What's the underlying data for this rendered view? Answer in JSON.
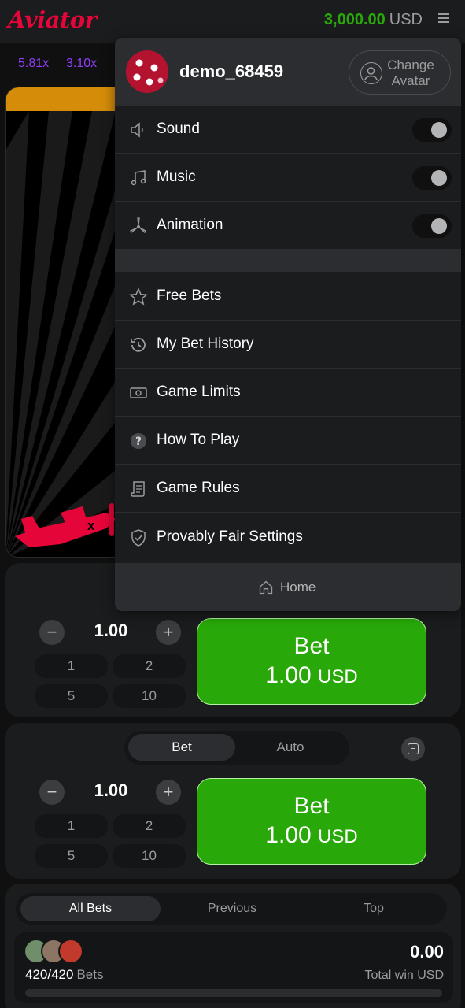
{
  "header": {
    "logo": "Aviator",
    "balance_amount": "3,000.00",
    "balance_currency": "USD",
    "menu_icon": "hamburger-icon"
  },
  "history": [
    "5.81x",
    "3.10x"
  ],
  "colors": {
    "brand": "#e50539",
    "green": "#28a909",
    "purple": "#913ef8",
    "orange": "#d58d09"
  },
  "menu": {
    "username": "demo_68459",
    "change_avatar": [
      "Change",
      "Avatar"
    ],
    "toggles": [
      {
        "label": "Sound",
        "icon": "speaker-icon",
        "on": false
      },
      {
        "label": "Music",
        "icon": "music-note-icon",
        "on": false
      },
      {
        "label": "Animation",
        "icon": "propeller-icon",
        "on": false
      }
    ],
    "items": [
      {
        "label": "Free Bets",
        "icon": "star-icon"
      },
      {
        "label": "My Bet History",
        "icon": "history-icon"
      },
      {
        "label": "Game Limits",
        "icon": "money-icon"
      },
      {
        "label": "How To Play",
        "icon": "question-icon"
      },
      {
        "label": "Game Rules",
        "icon": "scroll-icon"
      },
      {
        "label": "Provably Fair Settings",
        "icon": "shield-check-icon"
      }
    ],
    "home": "Home"
  },
  "bet_panel_1": {
    "amount": "1.00",
    "quick": [
      "1",
      "2",
      "5",
      "10"
    ],
    "bet_label": "Bet",
    "bet_amount": "1.00",
    "bet_currency": "USD"
  },
  "bet_panel_2": {
    "tabs": [
      "Bet",
      "Auto"
    ],
    "active_tab": "Bet",
    "amount": "1.00",
    "quick": [
      "1",
      "2",
      "5",
      "10"
    ],
    "bet_label": "Bet",
    "bet_amount": "1.00",
    "bet_currency": "USD"
  },
  "bets": {
    "tabs": [
      "All Bets",
      "Previous",
      "Top"
    ],
    "active_tab": "All Bets",
    "count": "420/420",
    "count_label": "Bets",
    "total": "0.00",
    "total_label": "Total win USD"
  }
}
